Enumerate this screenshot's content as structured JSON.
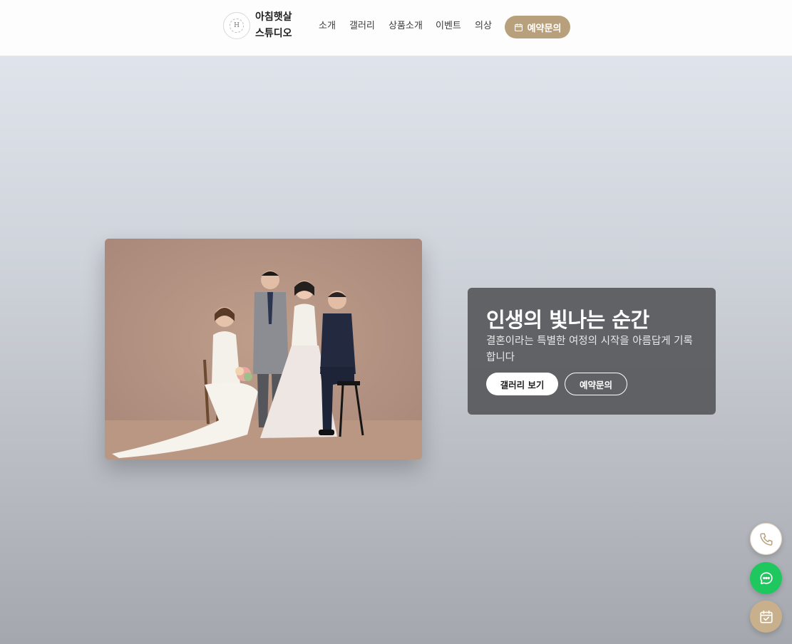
{
  "header": {
    "logo_letter": "H",
    "brand_line1": "아침햇살",
    "brand_line2": "스튜디오",
    "nav": [
      "소개",
      "갤러리",
      "상품소개",
      "이벤트",
      "의상"
    ],
    "cta_label": "예약문의",
    "cta_icon": "calendar-icon",
    "accent_color": "#b9a07d"
  },
  "hero": {
    "photo_icon": "wedding-family-photo",
    "title": "인생의 빛나는 순간",
    "subtitle": "결혼이라는 특별한 여정의 시작을 아름답게 기록합니다",
    "primary_button": "갤러리 보기",
    "secondary_button": "예약문의"
  },
  "floating": {
    "phone_icon": "phone-icon",
    "chat_icon": "chat-icon",
    "calendar_icon": "calendar-check-icon",
    "chat_color": "#1ec85f",
    "calendar_color": "#c8b08d"
  }
}
